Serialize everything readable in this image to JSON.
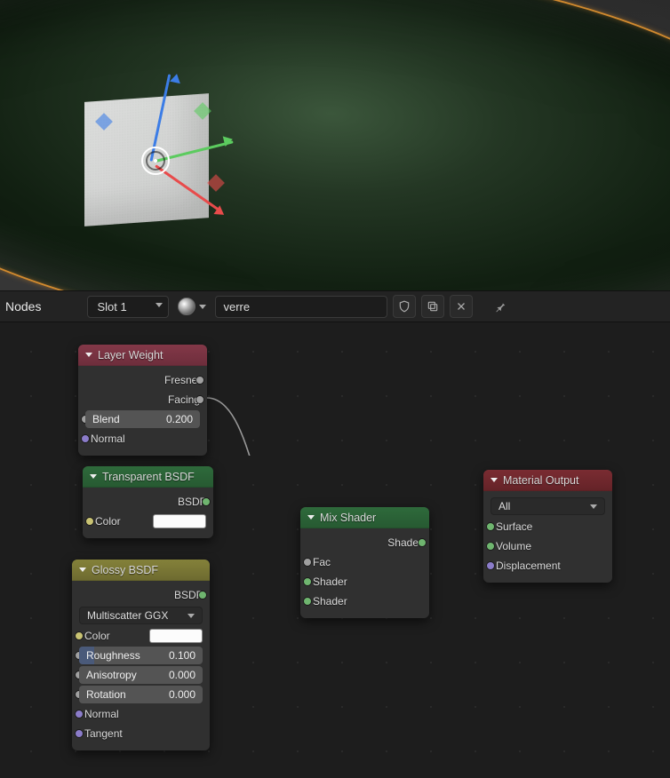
{
  "toolbar": {
    "editor_label": "Nodes",
    "slot_label": "Slot 1",
    "material_name": "verre"
  },
  "nodes": {
    "layer_weight": {
      "title": "Layer Weight",
      "out_fresnel": "Fresnel",
      "out_facing": "Facing",
      "blend_label": "Blend",
      "blend_value": "0.200",
      "in_normal": "Normal"
    },
    "transparent": {
      "title": "Transparent BSDF",
      "out_bsdf": "BSDF",
      "in_color": "Color"
    },
    "glossy": {
      "title": "Glossy BSDF",
      "out_bsdf": "BSDF",
      "distribution": "Multiscatter GGX",
      "in_color": "Color",
      "roughness_label": "Roughness",
      "roughness_value": "0.100",
      "anisotropy_label": "Anisotropy",
      "anisotropy_value": "0.000",
      "rotation_label": "Rotation",
      "rotation_value": "0.000",
      "in_normal": "Normal",
      "in_tangent": "Tangent"
    },
    "mix": {
      "title": "Mix Shader",
      "out_shader": "Shader",
      "in_fac": "Fac",
      "in_shader1": "Shader",
      "in_shader2": "Shader"
    },
    "output": {
      "title": "Material Output",
      "target": "All",
      "in_surface": "Surface",
      "in_volume": "Volume",
      "in_displacement": "Displacement"
    }
  }
}
